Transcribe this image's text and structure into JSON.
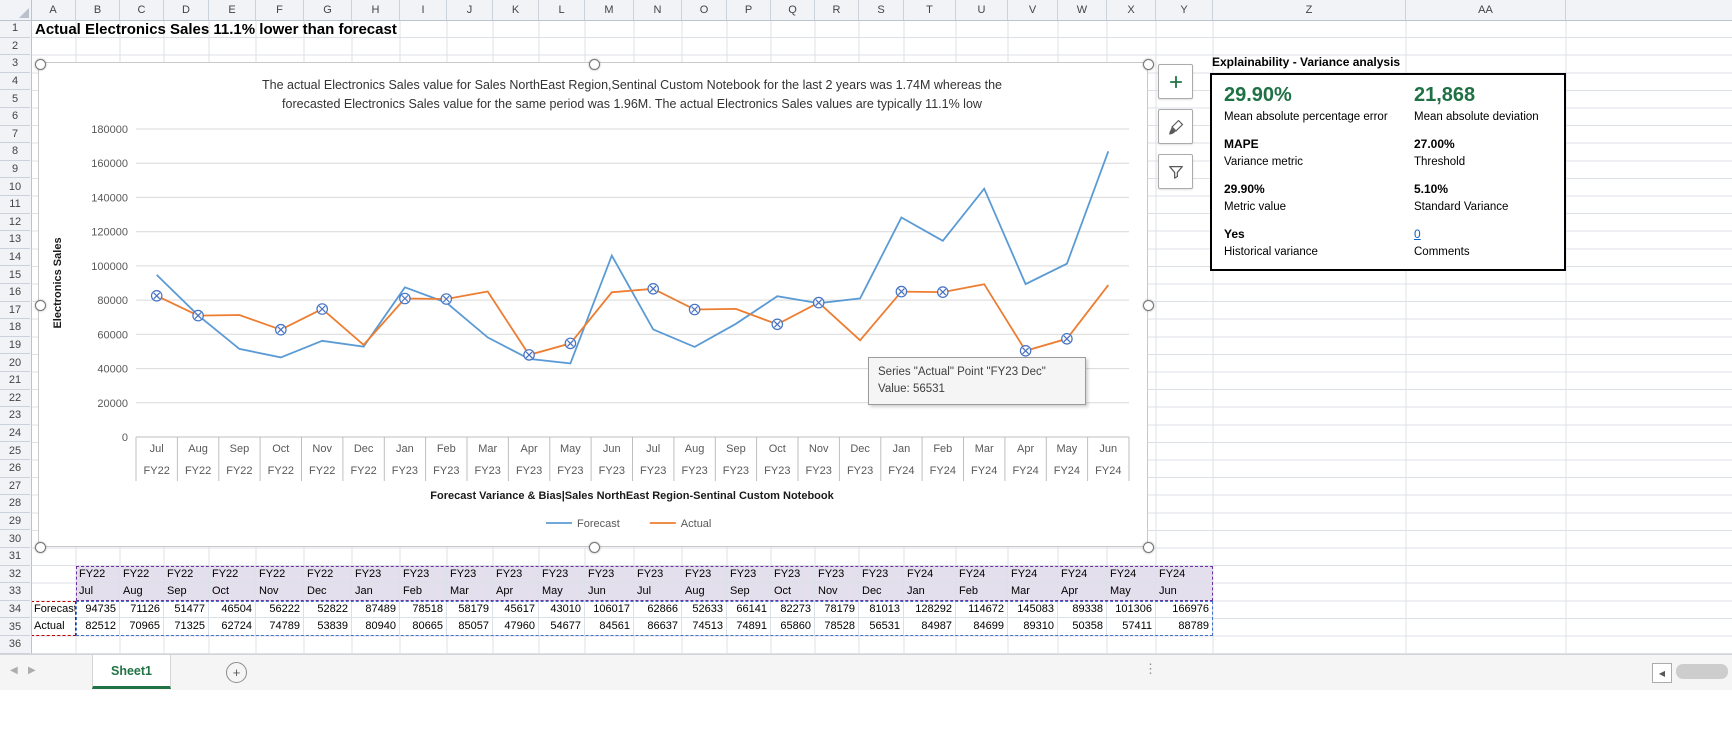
{
  "sheet": {
    "title_cell": "Actual Electronics Sales 11.1% lower than forecast",
    "tab_name": "Sheet1",
    "columns": [
      "A",
      "B",
      "C",
      "D",
      "E",
      "F",
      "G",
      "H",
      "I",
      "J",
      "K",
      "L",
      "M",
      "N",
      "O",
      "P",
      "Q",
      "R",
      "S",
      "T",
      "U",
      "V",
      "W",
      "X",
      "Y",
      "Z",
      "AA"
    ],
    "rows": [
      1,
      2,
      3,
      4,
      5,
      6,
      7,
      8,
      9,
      10,
      11,
      12,
      13,
      14,
      15,
      16,
      17,
      18,
      19,
      20,
      21,
      22,
      23,
      24,
      25,
      26,
      27,
      28,
      29,
      30,
      31,
      32,
      33,
      34,
      35,
      36
    ]
  },
  "chart_data": {
    "type": "line",
    "title": [
      "The actual Electronics Sales value for Sales NorthEast Region,Sentinal Custom Notebook for the last 2 years was 1.74M whereas the",
      "forecasted Electronics Sales value for the same period was 1.96M. The actual Electronics Sales values are typically 11.1% low"
    ],
    "ylabel": "Electronics Sales",
    "xlabel": "Forecast Variance & Bias|Sales NorthEast Region-Sentinal Custom Notebook",
    "ylim": [
      0,
      180000
    ],
    "ytick_step": 20000,
    "grid": true,
    "legend_position": "bottom",
    "categories_month": [
      "Jul",
      "Aug",
      "Sep",
      "Oct",
      "Nov",
      "Dec",
      "Jan",
      "Feb",
      "Mar",
      "Apr",
      "May",
      "Jun",
      "Jul",
      "Aug",
      "Sep",
      "Oct",
      "Nov",
      "Dec",
      "Jan",
      "Feb",
      "Mar",
      "Apr",
      "May",
      "Jun"
    ],
    "categories_fy": [
      "FY22",
      "FY22",
      "FY22",
      "FY22",
      "FY22",
      "FY22",
      "FY23",
      "FY23",
      "FY23",
      "FY23",
      "FY23",
      "FY23",
      "FY23",
      "FY23",
      "FY23",
      "FY23",
      "FY23",
      "FY23",
      "FY24",
      "FY24",
      "FY24",
      "FY24",
      "FY24",
      "FY24"
    ],
    "series": [
      {
        "name": "Forecast",
        "color": "#5B9BD5",
        "values": [
          94735,
          71126,
          51477,
          46504,
          56222,
          52822,
          87489,
          78518,
          58179,
          45617,
          43010,
          106017,
          62866,
          52633,
          66141,
          82273,
          78179,
          81013,
          128292,
          114672,
          145083,
          89338,
          101306,
          166976
        ]
      },
      {
        "name": "Actual",
        "color": "#ED7D31",
        "values": [
          82512,
          70965,
          71325,
          62724,
          74789,
          53839,
          80940,
          80665,
          85057,
          47960,
          54677,
          84561,
          86637,
          74513,
          74891,
          65860,
          78528,
          56531,
          84987,
          84699,
          89310,
          50358,
          57411,
          88789
        ],
        "marker_indices": [
          0,
          1,
          3,
          4,
          6,
          7,
          9,
          10,
          12,
          13,
          15,
          16,
          18,
          19,
          21,
          22
        ]
      }
    ],
    "marker_color": "#4472C4",
    "tooltip": {
      "line1": "Series \"Actual\" Point \"FY23 Dec\"",
      "line2": "Value: 56531"
    }
  },
  "panel": {
    "title": "Explainability - Variance analysis",
    "stats": [
      {
        "value": "29.90%",
        "label": "Mean absolute percentage error"
      },
      {
        "value": "21,868",
        "label": "Mean absolute deviation"
      },
      {
        "value": "MAPE",
        "label": "Variance metric"
      },
      {
        "value": "27.00%",
        "label": "Threshold"
      },
      {
        "value": "29.90%",
        "label": "Metric value"
      },
      {
        "value": "5.10%",
        "label": "Standard Variance"
      },
      {
        "value": "Yes",
        "label": "Historical variance"
      },
      {
        "value": "0",
        "label": "Comments"
      }
    ]
  },
  "colors": {
    "forecast": "#5B9BD5",
    "actual": "#ED7D31",
    "kpi_green": "#1E7145",
    "link_blue": "#0563C1",
    "sheet_green": "#217346",
    "category_fill": "#E4DFEC",
    "dash_purple": "#7030A0",
    "dash_blue": "#4472C4",
    "dash_red": "#C00000"
  }
}
